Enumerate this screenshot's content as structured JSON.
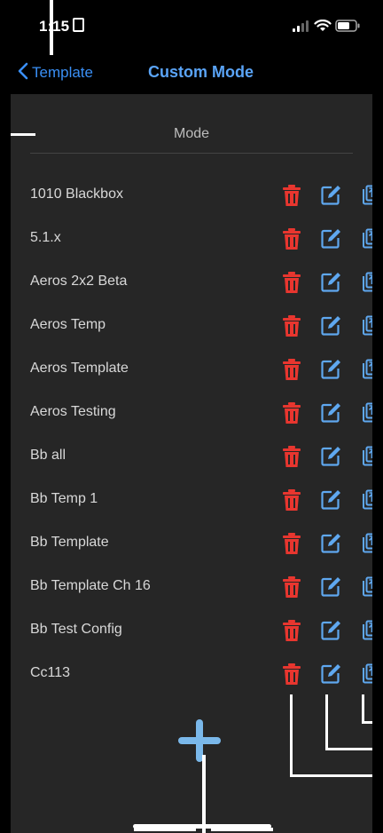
{
  "status_bar": {
    "time": "1:15"
  },
  "nav": {
    "back_label": "Template",
    "title": "Custom Mode"
  },
  "list": {
    "header": "Mode",
    "items": [
      "1010 Blackbox",
      "5.1.x",
      "Aeros 2x2 Beta",
      "Aeros Temp",
      "Aeros Template",
      "Aeros Testing",
      "Bb all",
      "Bb Temp 1",
      "Bb Template",
      "Bb Template Ch 16",
      "Bb Test Config",
      "Cc113"
    ]
  },
  "colors": {
    "accent": "#3a8ff5",
    "title_blue": "#5aa4f7",
    "delete_red": "#e8362f",
    "edit_blue": "#5fa8f0",
    "background": "#262626",
    "add_button": "#7ab8ea"
  },
  "icons": {
    "back": "chevron-left-icon",
    "delete": "trash-icon",
    "edit": "edit-icon",
    "copy": "duplicate-icon",
    "add": "plus-icon",
    "signal": "signal-icon",
    "wifi": "wifi-icon",
    "battery": "battery-icon"
  }
}
